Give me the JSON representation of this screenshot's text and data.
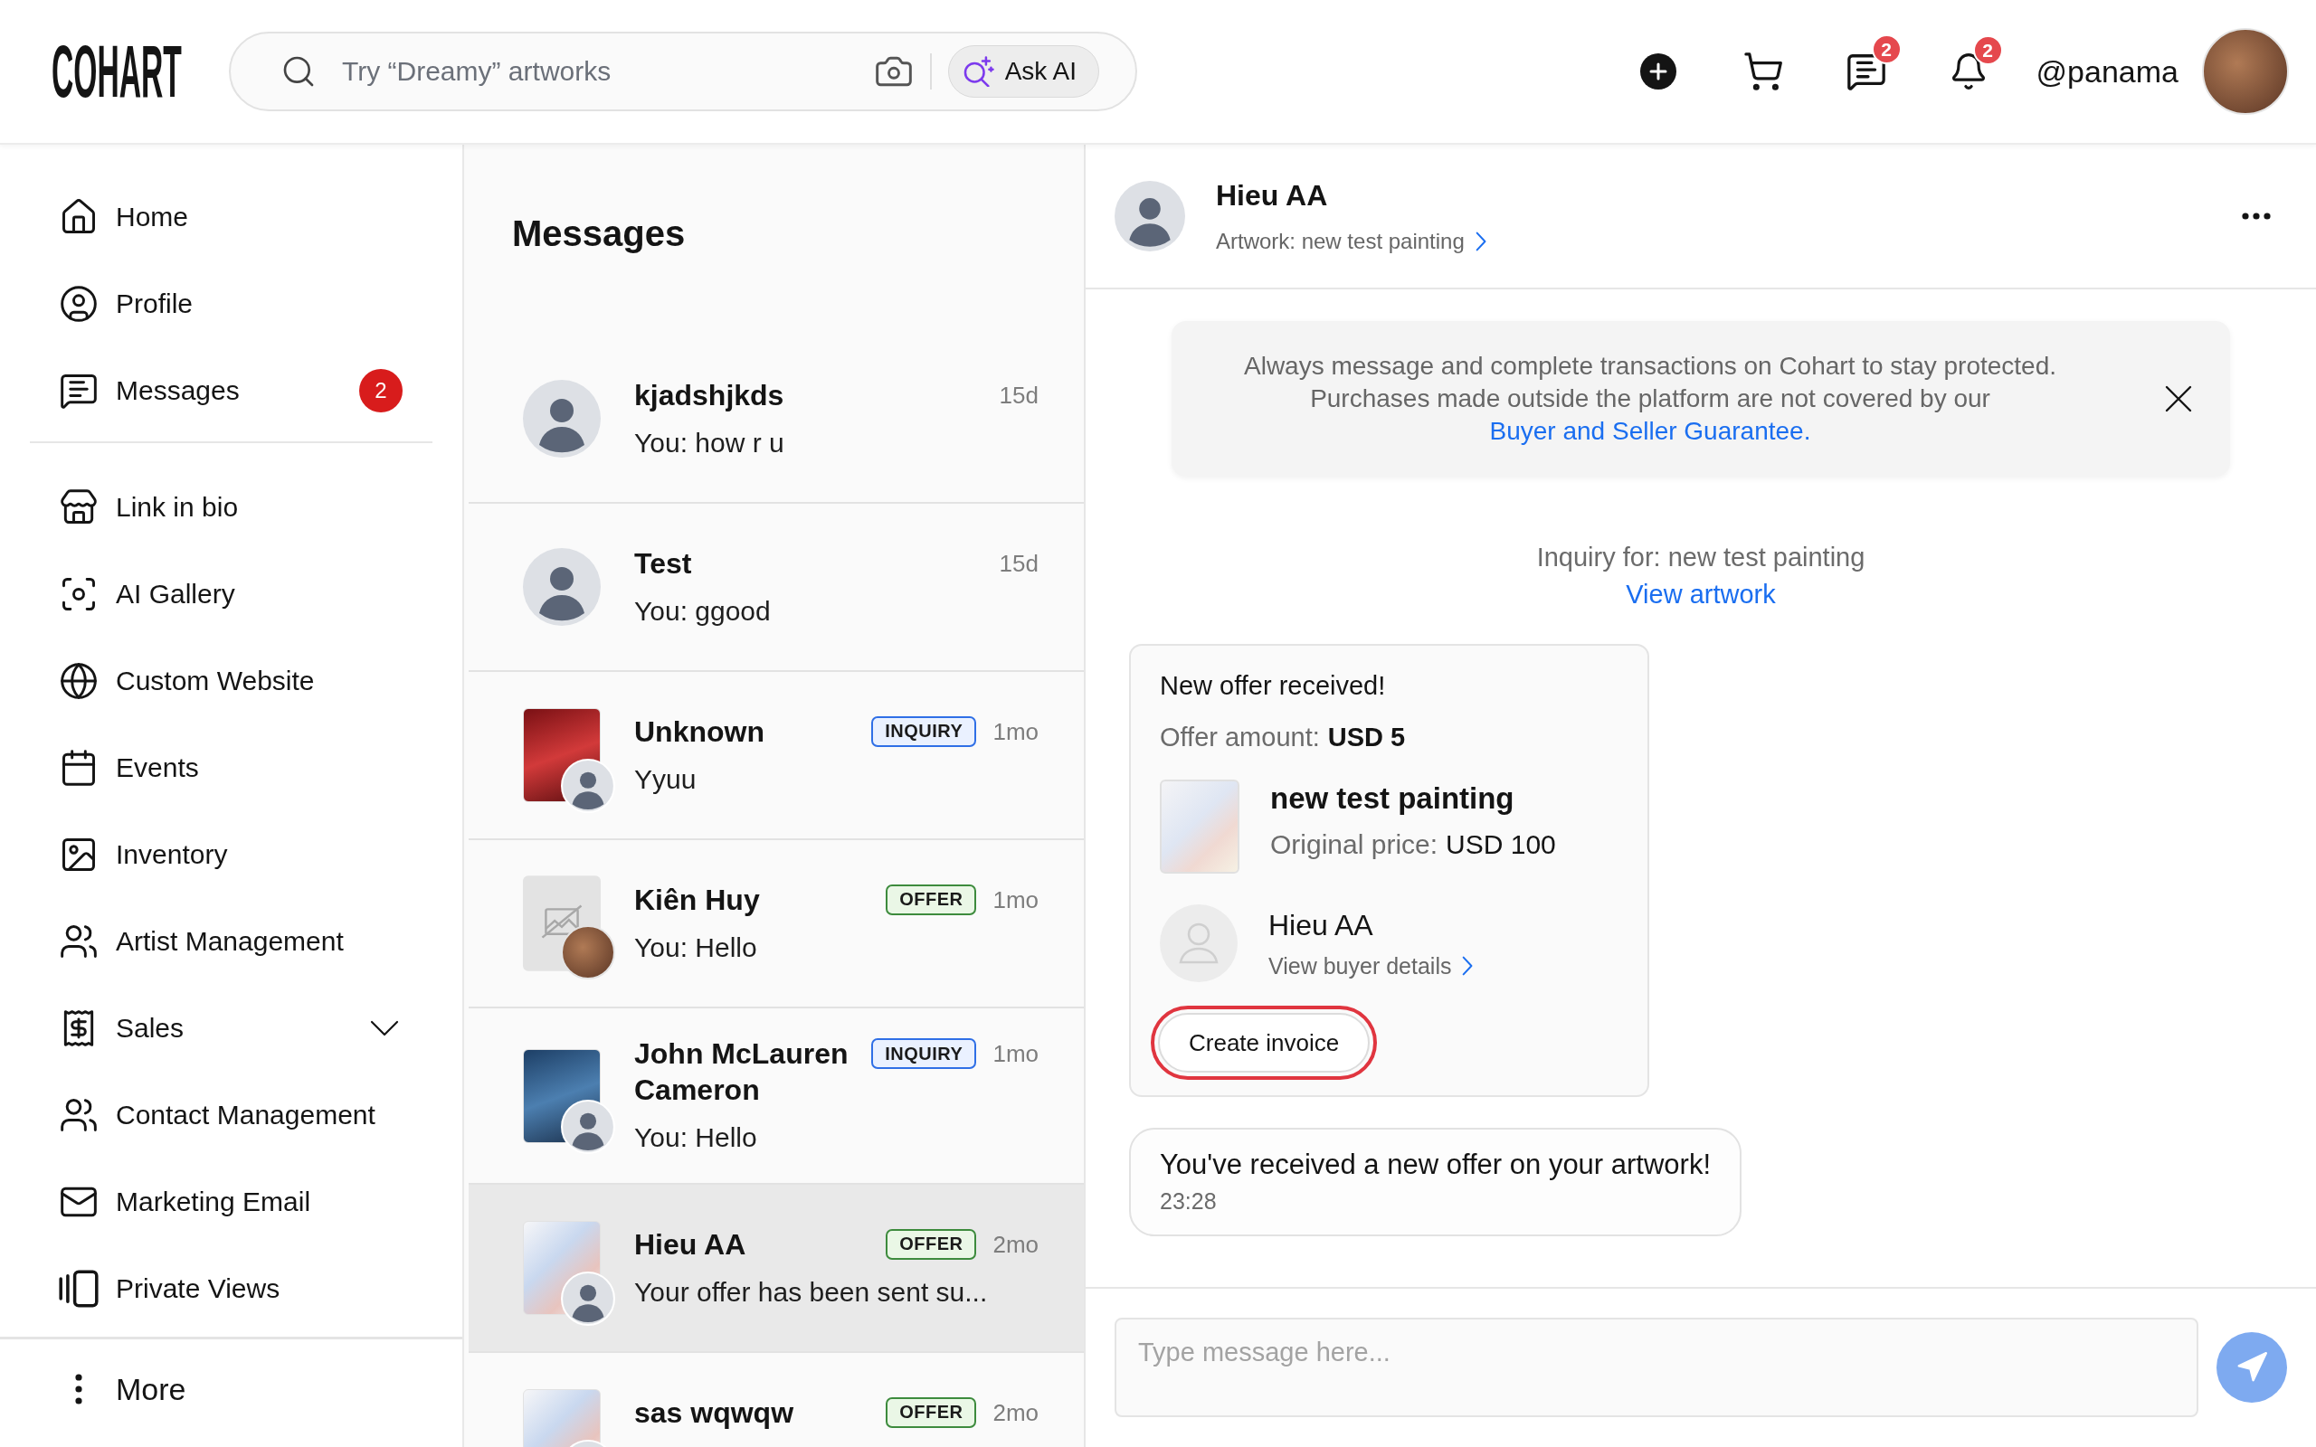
{
  "header": {
    "logo": "COHART",
    "search": {
      "placeholder": "Try “Dreamy” artworks"
    },
    "ask_ai": "Ask AI",
    "chat_badge": "2",
    "notification_badge": "2",
    "username": "@panama"
  },
  "sidebar": {
    "items": [
      {
        "label": "Home",
        "kind": "link"
      },
      {
        "label": "Profile",
        "kind": "link"
      },
      {
        "label": "Messages",
        "kind": "link",
        "badge": "2"
      }
    ],
    "tools": [
      {
        "label": "Link in bio",
        "kind": "link"
      },
      {
        "label": "AI Gallery",
        "kind": "link"
      },
      {
        "label": "Custom Website",
        "kind": "link"
      },
      {
        "label": "Events",
        "kind": "link"
      },
      {
        "label": "Inventory",
        "kind": "link"
      },
      {
        "label": "Artist Management",
        "kind": "link"
      },
      {
        "label": "Sales",
        "kind": "group",
        "expanded": false
      },
      {
        "label": "Contact Management",
        "kind": "link"
      },
      {
        "label": "Marketing Email",
        "kind": "link"
      },
      {
        "label": "Private Views",
        "kind": "link"
      }
    ],
    "more": "More"
  },
  "conversations": {
    "title": "Messages",
    "items": [
      {
        "name": "kjadshjkds",
        "preview": "You: how r u",
        "time": "15d",
        "kind": "contact",
        "selected": false
      },
      {
        "name": "Test",
        "preview": "You: ggood",
        "time": "15d",
        "kind": "contact",
        "selected": false
      },
      {
        "name": "Unknown",
        "preview": "Yyuu",
        "time": "1mo",
        "kind": "artwork",
        "tag": {
          "label": "INQUIRY",
          "kind": "inquiry"
        },
        "selected": false
      },
      {
        "name": "Kiên Huy",
        "preview": "You: Hello",
        "time": "1mo",
        "kind": "missing-artwork",
        "tag": {
          "label": "OFFER",
          "kind": "offer"
        },
        "selected": false
      },
      {
        "name": "John McLauren Cameron",
        "preview": "You: Hello",
        "time": "1mo",
        "kind": "artwork",
        "tag": {
          "label": "INQUIRY",
          "kind": "inquiry"
        },
        "selected": false
      },
      {
        "name": "Hieu AA",
        "preview": "Your offer has been sent su...",
        "time": "2mo",
        "kind": "artwork",
        "tag": {
          "label": "OFFER",
          "kind": "offer"
        },
        "selected": true
      },
      {
        "name": "sas wqwqw",
        "time": "2mo",
        "kind": "artwork",
        "tag": {
          "label": "OFFER",
          "kind": "offer"
        },
        "selected": false
      }
    ]
  },
  "chat": {
    "contact": {
      "name": "Hieu AA",
      "subtitle": "Artwork: new test painting"
    },
    "notice": {
      "text": "Always message and complete transactions on Cohart to stay protected. Purchases made outside the platform are not covered by our",
      "link": "Buyer and Seller Guarantee."
    },
    "inquiry": {
      "text": "Inquiry for: new test painting",
      "link": "View artwork"
    },
    "offer": {
      "title": "New offer received!",
      "amount_label": "Offer amount:",
      "amount": "USD 5",
      "artwork_title": "new test painting",
      "price_label": "Original price:",
      "price": "USD 100",
      "buyer_name": "Hieu AA",
      "buyer_link": "View buyer details",
      "button": {
        "label": "Create invoice",
        "highlighted": true
      }
    },
    "message": {
      "text": "You've received a new offer on your artwork!",
      "time": "23:28"
    },
    "composer": {
      "placeholder": "Type message here..."
    }
  }
}
